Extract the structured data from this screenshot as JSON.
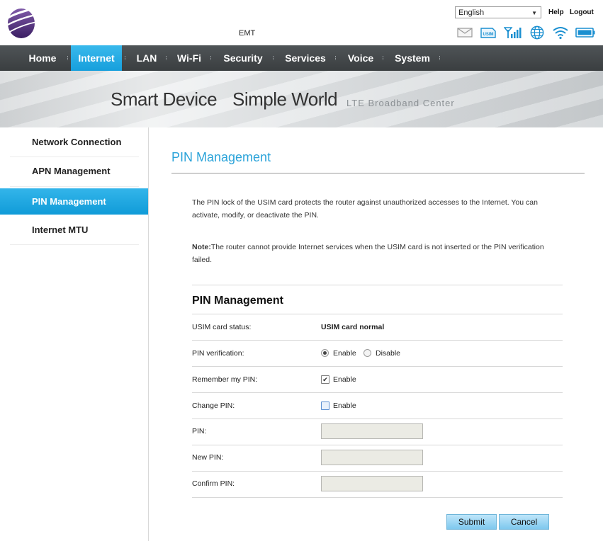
{
  "header": {
    "operator": "EMT",
    "language": "English",
    "help_label": "Help",
    "logout_label": "Logout"
  },
  "status_icons": [
    "mail-icon",
    "usim-icon",
    "signal-icon",
    "globe-icon",
    "wifi-icon",
    "battery-icon"
  ],
  "usim_icon_text": "USIM",
  "nav": {
    "items": [
      "Home",
      "Internet",
      "LAN",
      "Wi-Fi",
      "Security",
      "Services",
      "Voice",
      "System"
    ],
    "active": "Internet"
  },
  "banner": {
    "text1": "Smart Device",
    "text2": "Simple World",
    "text3": "LTE  Broadband  Center"
  },
  "sidebar": {
    "items": [
      "Network Connection",
      "APN Management",
      "PIN Management",
      "Internet MTU"
    ],
    "active": "PIN Management"
  },
  "content": {
    "title": "PIN Management",
    "description": "The PIN lock of the USIM card protects the router against unauthorized accesses to the Internet. You can activate, modify, or deactivate the PIN.",
    "note_label": "Note:",
    "note_text": "The router cannot provide Internet services when the USIM card is not inserted or the PIN verification failed."
  },
  "form": {
    "title": "PIN Management",
    "usim_status_label": "USIM card status:",
    "usim_status_value": "USIM card normal",
    "pin_verification_label": "PIN verification:",
    "enable_label": "Enable",
    "disable_label": "Disable",
    "pin_verification_selected": "Enable",
    "remember_pin_label": "Remember my PIN:",
    "remember_pin_checked": true,
    "change_pin_label": "Change PIN:",
    "change_pin_checked": false,
    "pin_label": "PIN:",
    "new_pin_label": "New PIN:",
    "confirm_pin_label": "Confirm PIN:",
    "pin_value": "",
    "new_pin_value": "",
    "confirm_pin_value": ""
  },
  "buttons": {
    "submit": "Submit",
    "cancel": "Cancel"
  },
  "colors": {
    "accent": "#1ea7e1",
    "nav_bg": "#45494c",
    "title_blue": "#2aa3d9"
  }
}
